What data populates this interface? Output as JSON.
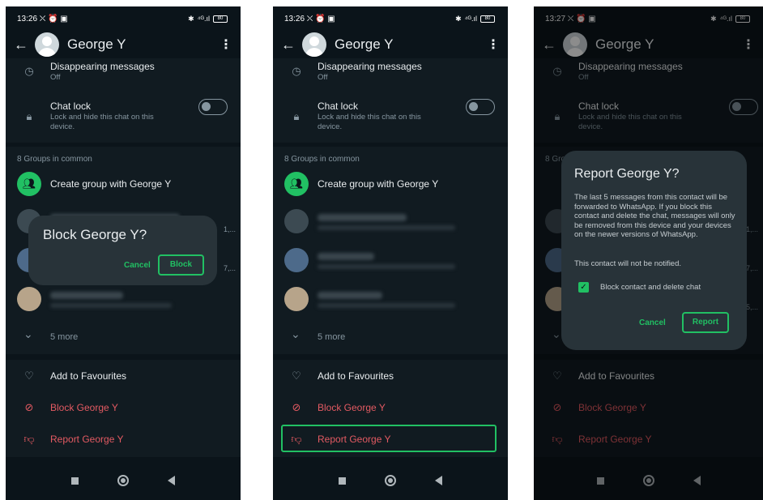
{
  "contact": {
    "name": "George Y"
  },
  "panels": [
    {
      "time": "13:26",
      "status_icons": "⛌ ⏰ ▣"
    },
    {
      "time": "13:26",
      "status_icons": "⛌ ⏰ ▣"
    },
    {
      "time": "13:27",
      "status_icons": "⛌ ⏰ ▣"
    }
  ],
  "status_right": {
    "signal": "⁴ᴳ.ıl",
    "battery": "80"
  },
  "info": {
    "disappearing_title": "Disappearing messages",
    "disappearing_value": "Off",
    "chatlock_title": "Chat lock",
    "chatlock_sub": "Lock and hide this chat on this device.",
    "groups_label": "8 Groups in common",
    "create_group": "Create group with George Y",
    "more": "5 more"
  },
  "actions": {
    "favourites": "Add to Favourites",
    "block": "Block George Y",
    "report": "Report George Y"
  },
  "block_dialog": {
    "title": "Block George Y?",
    "cancel": "Cancel",
    "confirm": "Block"
  },
  "report_dialog": {
    "title": "Report George Y?",
    "body": "The last 5 messages from this contact will be forwarded to WhatsApp. If you block this contact and delete the chat, messages will only be removed from this device and your devices on the newer versions of WhatsApp.",
    "note": "This contact will not be notified.",
    "checkbox_label": "Block contact and delete chat",
    "checkbox_checked": true,
    "cancel": "Cancel",
    "confirm": "Report"
  },
  "colors": {
    "accent": "#21c063",
    "danger": "#e35a62",
    "background": "#0b141a",
    "card": "#111b21"
  },
  "icons": {
    "back": "arrow-left-icon",
    "menu": "kebab-menu-icon",
    "timer": "timer-icon",
    "lock": "lock-icon",
    "group": "group-icon",
    "chevron": "chevron-down-icon",
    "heart": "heart-icon",
    "block": "block-icon",
    "report": "thumb-down-icon"
  }
}
